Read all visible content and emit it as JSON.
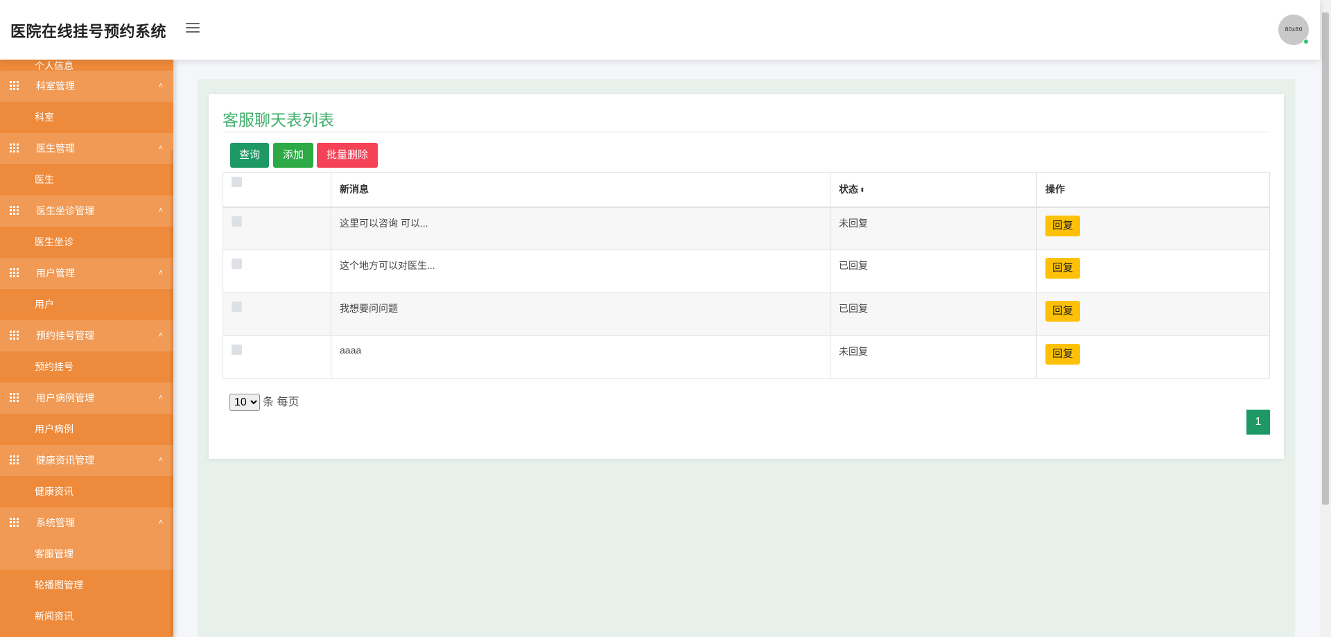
{
  "header": {
    "title": "医院在线挂号预约系统",
    "avatar_text": "80x80"
  },
  "sidebar": {
    "top_item": "个人信息",
    "groups": [
      {
        "label": "科室管理",
        "items": [
          "科室"
        ]
      },
      {
        "label": "医生管理",
        "items": [
          "医生"
        ]
      },
      {
        "label": "医生坐诊管理",
        "items": [
          "医生坐诊"
        ]
      },
      {
        "label": "用户管理",
        "items": [
          "用户"
        ]
      },
      {
        "label": "预约挂号管理",
        "items": [
          "预约挂号"
        ]
      },
      {
        "label": "用户病例管理",
        "items": [
          "用户病例"
        ]
      },
      {
        "label": "健康资讯管理",
        "items": [
          "健康资讯"
        ]
      },
      {
        "label": "系统管理",
        "items": [
          "客服管理",
          "轮播图管理",
          "新闻资讯"
        ]
      }
    ],
    "caret": "˄"
  },
  "main": {
    "title": "客服聊天表列表",
    "buttons": {
      "query": "查询",
      "add": "添加",
      "batch_delete": "批量删除"
    },
    "table": {
      "columns": [
        "新消息",
        "状态",
        "操作"
      ],
      "sort_icon": "⬍",
      "rows": [
        {
          "message": "这里可以咨询 可以...",
          "status": "未回复",
          "action": "回复"
        },
        {
          "message": "这个地方可以对医生...",
          "status": "已回复",
          "action": "回复"
        },
        {
          "message": "我想要问问题",
          "status": "已回复",
          "action": "回复"
        },
        {
          "message": "aaaa",
          "status": "未回复",
          "action": "回复"
        }
      ]
    },
    "page_size": {
      "value": "10",
      "suffix": "条 每页"
    },
    "current_page": "1"
  },
  "colors": {
    "sidebar": "#ee8a3b",
    "sidebar_group": "#f09a55",
    "accent_green": "#1e9966",
    "title_green": "#3fae6b",
    "danger": "#f54257",
    "warning": "#ffc107"
  }
}
